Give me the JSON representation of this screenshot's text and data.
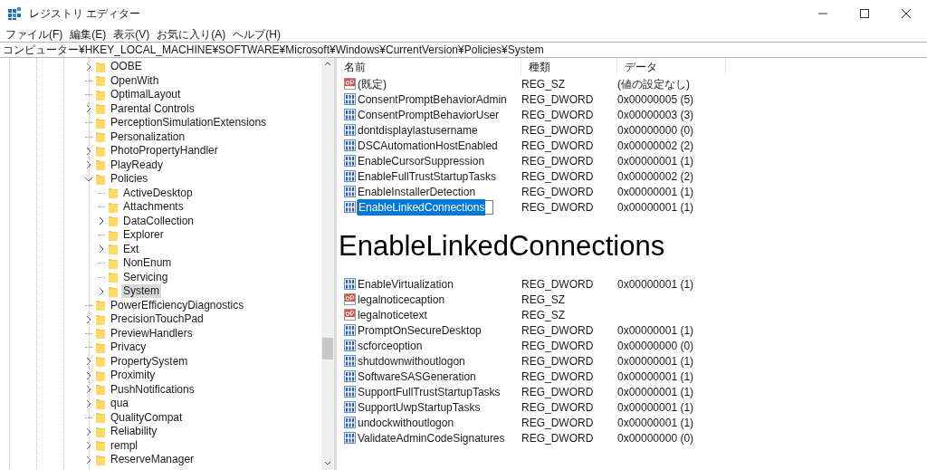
{
  "window": {
    "title": "レジストリ エディター"
  },
  "menu": [
    "ファイル(F)",
    "編集(E)",
    "表示(V)",
    "お気に入り(A)",
    "ヘルプ(H)"
  ],
  "address_bar": "コンピューター¥HKEY_LOCAL_MACHINE¥SOFTWARE¥Microsoft¥Windows¥CurrentVersion¥Policies¥System",
  "tree": [
    {
      "label": "OOBE",
      "expandable": true,
      "expanded": false,
      "selected": false
    },
    {
      "label": "OpenWith",
      "expandable": false,
      "selected": false
    },
    {
      "label": "OptimalLayout",
      "expandable": false,
      "selected": false
    },
    {
      "label": "Parental Controls",
      "expandable": true,
      "expanded": false,
      "selected": false
    },
    {
      "label": "PerceptionSimulationExtensions",
      "expandable": false,
      "selected": false
    },
    {
      "label": "Personalization",
      "expandable": false,
      "selected": false
    },
    {
      "label": "PhotoPropertyHandler",
      "expandable": true,
      "expanded": false,
      "selected": false
    },
    {
      "label": "PlayReady",
      "expandable": true,
      "expanded": false,
      "selected": false
    },
    {
      "label": "Policies",
      "expandable": true,
      "expanded": true,
      "selected": false,
      "children": [
        {
          "label": "ActiveDesktop",
          "expandable": false,
          "selected": false
        },
        {
          "label": "Attachments",
          "expandable": false,
          "selected": false
        },
        {
          "label": "DataCollection",
          "expandable": true,
          "expanded": false,
          "selected": false
        },
        {
          "label": "Explorer",
          "expandable": false,
          "selected": false
        },
        {
          "label": "Ext",
          "expandable": true,
          "expanded": false,
          "selected": false
        },
        {
          "label": "NonEnum",
          "expandable": false,
          "selected": false
        },
        {
          "label": "Servicing",
          "expandable": false,
          "selected": false
        },
        {
          "label": "System",
          "expandable": true,
          "expanded": false,
          "selected": true
        }
      ]
    },
    {
      "label": "PowerEfficiencyDiagnostics",
      "expandable": false,
      "selected": false
    },
    {
      "label": "PrecisionTouchPad",
      "expandable": true,
      "expanded": false,
      "selected": false
    },
    {
      "label": "PreviewHandlers",
      "expandable": false,
      "selected": false
    },
    {
      "label": "Privacy",
      "expandable": false,
      "selected": false
    },
    {
      "label": "PropertySystem",
      "expandable": true,
      "expanded": false,
      "selected": false
    },
    {
      "label": "Proximity",
      "expandable": true,
      "expanded": false,
      "selected": false
    },
    {
      "label": "PushNotifications",
      "expandable": true,
      "expanded": false,
      "selected": false
    },
    {
      "label": "qua",
      "expandable": true,
      "expanded": false,
      "selected": false
    },
    {
      "label": "QualityCompat",
      "expandable": false,
      "selected": false
    },
    {
      "label": "Reliability",
      "expandable": true,
      "expanded": false,
      "selected": false
    },
    {
      "label": "rempl",
      "expandable": true,
      "expanded": false,
      "selected": false
    },
    {
      "label": "ReserveManager",
      "expandable": true,
      "expanded": false,
      "selected": false
    }
  ],
  "values": {
    "columns": [
      "名前",
      "種類",
      "データ"
    ],
    "rows": [
      {
        "kind": "sz",
        "name": "(既定)",
        "type": "REG_SZ",
        "data": "(値の設定なし)",
        "selected": false
      },
      {
        "kind": "dword",
        "name": "ConsentPromptBehaviorAdmin",
        "type": "REG_DWORD",
        "data": "0x00000005 (5)",
        "selected": false
      },
      {
        "kind": "dword",
        "name": "ConsentPromptBehaviorUser",
        "type": "REG_DWORD",
        "data": "0x00000003 (3)",
        "selected": false
      },
      {
        "kind": "dword",
        "name": "dontdisplaylastusername",
        "type": "REG_DWORD",
        "data": "0x00000000 (0)",
        "selected": false
      },
      {
        "kind": "dword",
        "name": "DSCAutomationHostEnabled",
        "type": "REG_DWORD",
        "data": "0x00000002 (2)",
        "selected": false
      },
      {
        "kind": "dword",
        "name": "EnableCursorSuppression",
        "type": "REG_DWORD",
        "data": "0x00000001 (1)",
        "selected": false
      },
      {
        "kind": "dword",
        "name": "EnableFullTrustStartupTasks",
        "type": "REG_DWORD",
        "data": "0x00000002 (2)",
        "selected": false
      },
      {
        "kind": "dword",
        "name": "EnableInstallerDetection",
        "type": "REG_DWORD",
        "data": "0x00000001 (1)",
        "selected": false
      },
      {
        "kind": "dword",
        "name": "EnableLinkedConnections",
        "type": "REG_DWORD",
        "data": "0x00000001 (1)",
        "selected": true
      },
      {
        "kind": "callout",
        "text": "EnableLinkedConnections"
      },
      {
        "kind": "dword",
        "name": "EnableVirtualization",
        "type": "REG_DWORD",
        "data": "0x00000001 (1)",
        "selected": false
      },
      {
        "kind": "sz",
        "name": "legalnoticecaption",
        "type": "REG_SZ",
        "selected": false
      },
      {
        "kind": "sz",
        "name": "legalnoticetext",
        "type": "REG_SZ",
        "selected": false
      },
      {
        "kind": "dword",
        "name": "PromptOnSecureDesktop",
        "type": "REG_DWORD",
        "data": "0x00000001 (1)",
        "selected": false
      },
      {
        "kind": "dword",
        "name": "scforceoption",
        "type": "REG_DWORD",
        "data": "0x00000000 (0)",
        "selected": false
      },
      {
        "kind": "dword",
        "name": "shutdownwithoutlogon",
        "type": "REG_DWORD",
        "data": "0x00000001 (1)",
        "selected": false
      },
      {
        "kind": "dword",
        "name": "SoftwareSASGeneration",
        "type": "REG_DWORD",
        "data": "0x00000001 (1)",
        "selected": false
      },
      {
        "kind": "dword",
        "name": "SupportFullTrustStartupTasks",
        "type": "REG_DWORD",
        "data": "0x00000001 (1)",
        "selected": false
      },
      {
        "kind": "dword",
        "name": "SupportUwpStartupTasks",
        "type": "REG_DWORD",
        "data": "0x00000001 (1)",
        "selected": false
      },
      {
        "kind": "dword",
        "name": "undockwithoutlogon",
        "type": "REG_DWORD",
        "data": "0x00000001 (1)",
        "selected": false
      },
      {
        "kind": "dword",
        "name": "ValidateAdminCodeSignatures",
        "type": "REG_DWORD",
        "data": "0x00000000 (0)",
        "selected": false
      }
    ]
  }
}
